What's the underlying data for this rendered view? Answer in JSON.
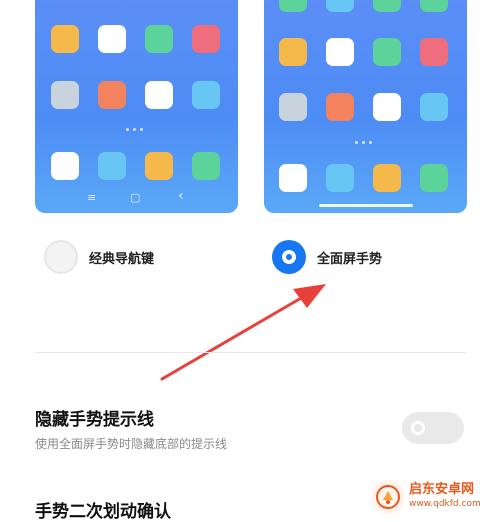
{
  "options": [
    {
      "label": "经典导航键",
      "selected": false
    },
    {
      "label": "全面屏手势",
      "selected": true
    }
  ],
  "classic_nav_buttons": [
    {
      "icon": "menu-icon",
      "glyph": "≡"
    },
    {
      "icon": "home-icon",
      "glyph": "▢"
    },
    {
      "icon": "back-icon",
      "glyph": "‹"
    }
  ],
  "settings": [
    {
      "title": "隐藏手势提示线",
      "subtitle": "使用全面屏手势时隐藏底部的提示线",
      "toggle_on": false
    },
    {
      "title": "手势二次划动确认"
    }
  ],
  "watermark": {
    "name": "启东安卓网",
    "url": "www.qdkfd.com"
  },
  "colors": {
    "accent": "#1677f0",
    "arrow": "#e8403a",
    "preview_bg": "#4e8cf5",
    "tile_yellow": "#f5b84a",
    "tile_white": "#ffffff",
    "tile_green": "#5bd39a",
    "tile_pink": "#ee6e7e",
    "tile_gray": "#c9d3de",
    "tile_orange": "#f3835f",
    "tile_sky": "#67c6f3"
  }
}
